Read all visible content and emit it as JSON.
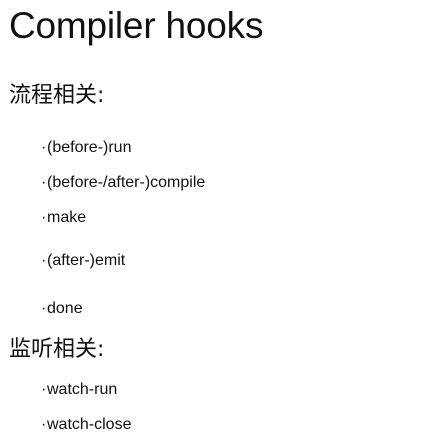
{
  "title": "Compiler hooks",
  "sections": [
    {
      "heading": "流程相关:",
      "items": [
        "(before-)run",
        "(before-/after-)compile",
        "make",
        "(after-)emit",
        "done"
      ]
    },
    {
      "heading": "监听相关:",
      "items": [
        "watch-run",
        "watch-close"
      ]
    }
  ],
  "bullet": "·"
}
